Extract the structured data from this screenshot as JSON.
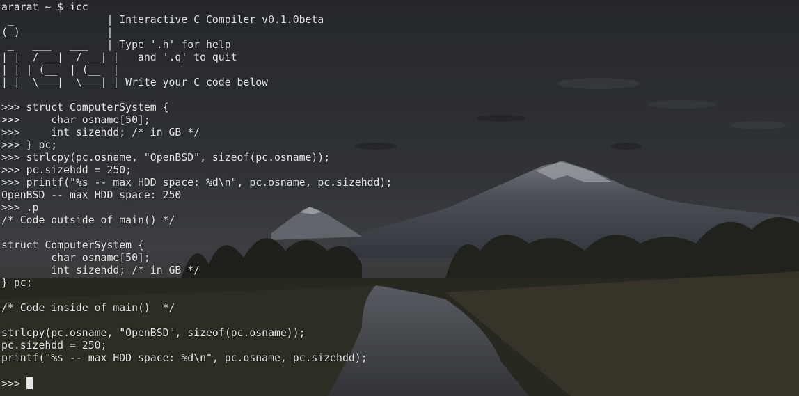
{
  "terminal": {
    "lines": [
      "ararat ~ $ icc",
      " _               | Interactive C Compiler v0.1.0beta",
      "(_)              |",
      " _   ___   ___   | Type '.h' for help",
      "| |  / __|  / __| |   and '.q' to quit",
      "| | | (__  | (__  |",
      "|_|  \\___|  \\___| | Write your C code below",
      "",
      ">>> struct ComputerSystem {",
      ">>>     char osname[50];",
      ">>>     int sizehdd; /* in GB */",
      ">>> } pc;",
      ">>> strlcpy(pc.osname, \"OpenBSD\", sizeof(pc.osname));",
      ">>> pc.sizehdd = 250;",
      ">>> printf(\"%s -- max HDD space: %d\\n\", pc.osname, pc.sizehdd);",
      "OpenBSD -- max HDD space: 250",
      ">>> .p",
      "/* Code outside of main() */",
      "",
      "struct ComputerSystem {",
      "        char osname[50];",
      "        int sizehdd; /* in GB */",
      "} pc;",
      "",
      "/* Code inside of main()  */",
      "",
      "strlcpy(pc.osname, \"OpenBSD\", sizeof(pc.osname));",
      "pc.sizehdd = 250;",
      "printf(\"%s -- max HDD space: %d\\n\", pc.osname, pc.sizehdd);",
      ""
    ],
    "prompt": ">>> "
  },
  "colors": {
    "text": "#e6e6e6",
    "cursor": "#e6e6e6"
  }
}
